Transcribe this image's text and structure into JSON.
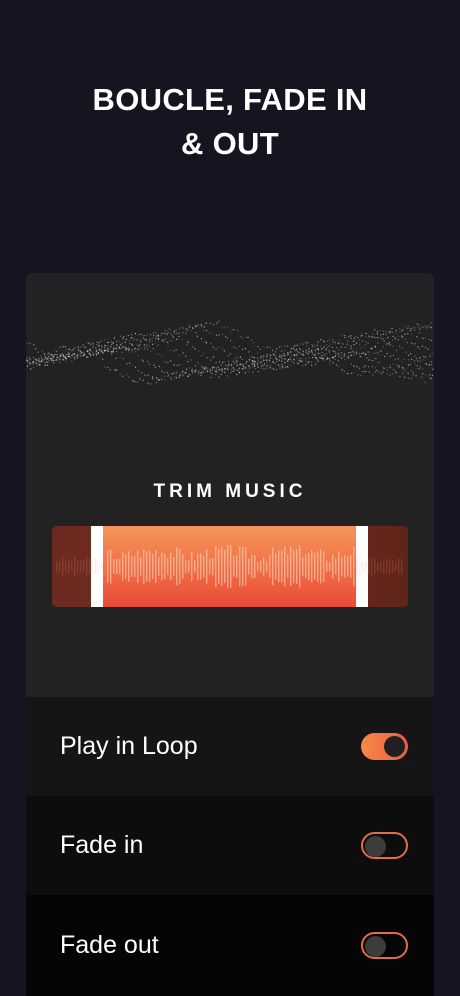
{
  "headline": {
    "line1": "BOUCLE, FADE IN",
    "line2": "& OUT"
  },
  "trim": {
    "label": "TRIM MUSIC"
  },
  "settings": [
    {
      "label": "Play in Loop",
      "enabled": true
    },
    {
      "label": "Fade in",
      "enabled": false
    },
    {
      "label": "Fade out",
      "enabled": false
    }
  ],
  "colors": {
    "accent": "#f06a42",
    "background": "#141520",
    "card": "#222222"
  }
}
